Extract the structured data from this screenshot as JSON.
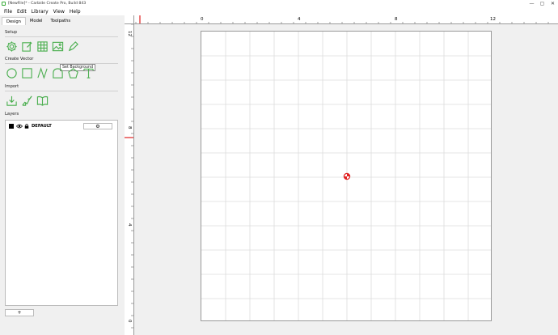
{
  "window": {
    "title": "[NewFile]* - Carbide Create Pro, Build 843",
    "min_glyph": "—",
    "max_glyph": "▢",
    "close_glyph": "✕"
  },
  "menu": [
    "File",
    "Edit",
    "Library",
    "View",
    "Help"
  ],
  "tabs": [
    "Design",
    "Model",
    "Toolpaths"
  ],
  "sections": {
    "setup": "Setup",
    "create_vector": "Create Vector",
    "import": "Import",
    "layers": "Layers"
  },
  "tooltip": "Set Background",
  "layer": {
    "name": "DEFAULT"
  },
  "add_label": "+",
  "gear_glyph": "⚙",
  "ruler": {
    "h_labels": [
      "0",
      "4",
      "8",
      "12"
    ],
    "v_labels": [
      "12",
      "8",
      "4",
      "0"
    ]
  },
  "colors": {
    "accent": "#4caf50",
    "marker": "#e02020"
  }
}
